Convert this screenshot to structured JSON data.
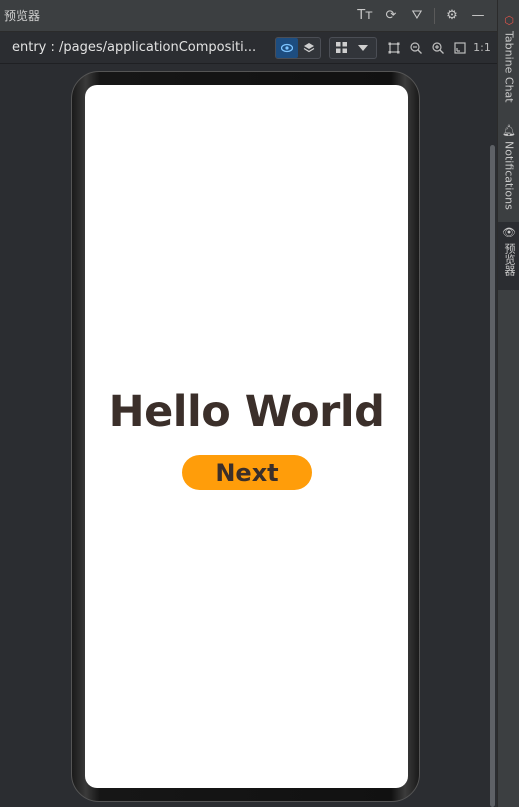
{
  "titlebar": {
    "title": "预览器",
    "font_size_icon": "Tт",
    "refresh_icon": "⟳",
    "inspect_icon": "⛛",
    "settings_icon": "⚙",
    "minimize_icon": "—"
  },
  "pathbar": {
    "path": "entry : /pages/applicationCompositi...",
    "zoom_ratio": "1:1"
  },
  "preview": {
    "heading": "Hello World",
    "button_label": "Next",
    "button_color": "#ff9d0a",
    "text_color": "#3b2f2a"
  },
  "sidebar": {
    "tabs": [
      {
        "label": "Tabnine Chat"
      },
      {
        "label": "Notifications"
      },
      {
        "label": "预览器"
      }
    ]
  }
}
